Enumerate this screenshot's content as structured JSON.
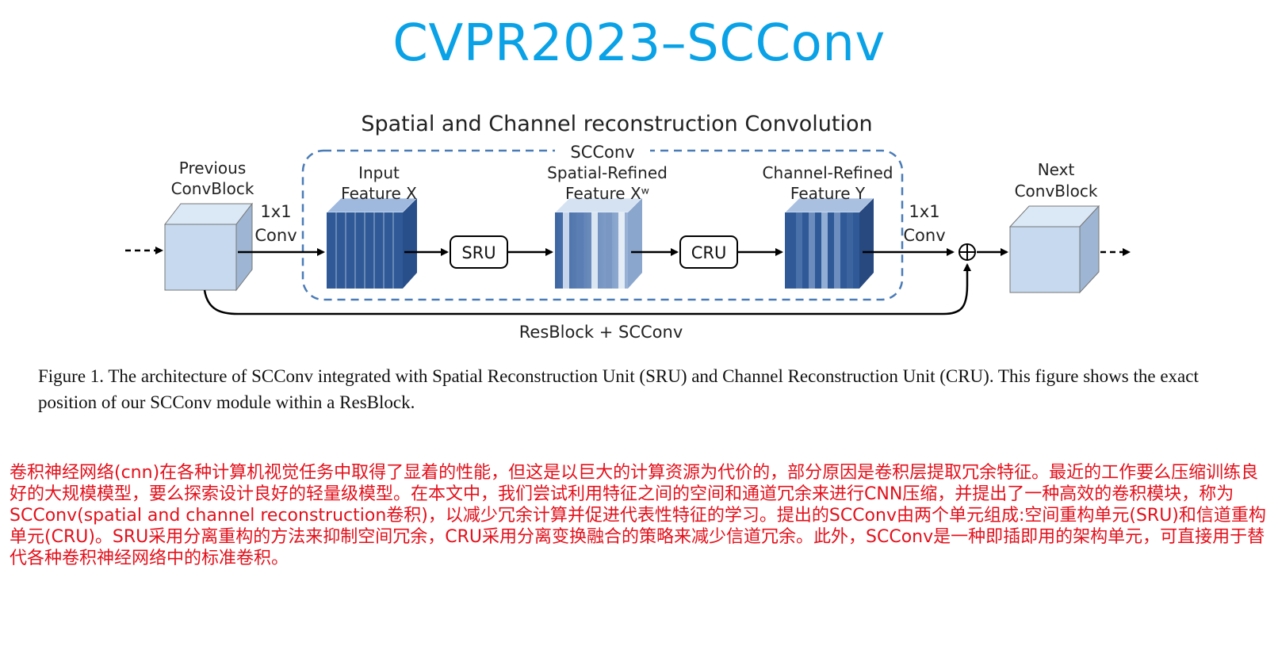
{
  "page_title": "CVPR2023–SCConv",
  "figure": {
    "title": "Spatial and Channel reconstruction Convolution",
    "scconv_box_label": "SCConv",
    "prev_block_label": [
      "Previous",
      "ConvBlock"
    ],
    "next_block_label": [
      "Next",
      "ConvBlock"
    ],
    "conv_in_label": [
      "1x1",
      "Conv"
    ],
    "conv_out_label": [
      "1x1",
      "Conv"
    ],
    "input_feature_label": [
      "Input",
      "Feature X"
    ],
    "spatial_feature_label": [
      "Spatial-Refined",
      "Feature Xʷ"
    ],
    "channel_feature_label": [
      "Channel-Refined",
      "Feature Y"
    ],
    "sru_label": "SRU",
    "cru_label": "CRU",
    "sum_symbol": "⊕",
    "resblock_label": "ResBlock + SCConv",
    "colors": {
      "accent_blue": "#2f5a97",
      "box_light": "#c6d9ef",
      "dashed": "#4a7bb7"
    }
  },
  "caption": "Figure 1. The architecture of SCConv integrated with Spatial Reconstruction Unit (SRU) and Channel Reconstruction Unit (CRU). This figure shows the exact position of our SCConv module within a ResBlock.",
  "abstract_zh": "卷积神经网络(cnn)在各种计算机视觉任务中取得了显着的性能，但这是以巨大的计算资源为代价的，部分原因是卷积层提取冗余特征。最近的工作要么压缩训练良好的大规模模型，要么探索设计良好的轻量级模型。在本文中，我们尝试利用特征之间的空间和通道冗余来进行CNN压缩，并提出了一种高效的卷积模块，称为SCConv(spatial and channel reconstruction卷积)，以减少冗余计算并促进代表性特征的学习。提出的SCConv由两个单元组成:空间重构单元(SRU)和信道重构单元(CRU)。SRU采用分离重构的方法来抑制空间冗余，CRU采用分离变换融合的策略来减少信道冗余。此外，SCConv是一种即插即用的架构单元，可直接用于替代各种卷积神经网络中的标准卷积。"
}
